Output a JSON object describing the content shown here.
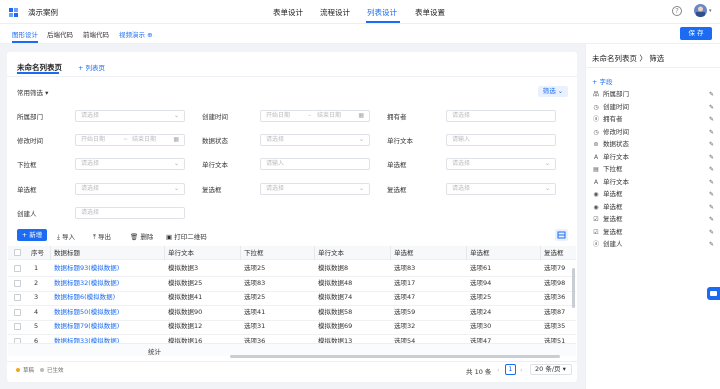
{
  "app": {
    "title": "演示案例"
  },
  "top_tabs": [
    {
      "label": "表单设计"
    },
    {
      "label": "流程设计"
    },
    {
      "label": "列表设计"
    },
    {
      "label": "表单设置"
    }
  ],
  "header": {
    "help": "?",
    "avatar_caret": "▾"
  },
  "sub_tabs": [
    {
      "label": "图形设计"
    },
    {
      "label": "后端代码"
    },
    {
      "label": "前端代码"
    },
    {
      "label": "视频演示 ⊕"
    }
  ],
  "save_label": "保 存",
  "card": {
    "title": "未命名列表页",
    "add_list": "+ 列表页",
    "common_filter": "常用筛选 ▾",
    "filter_btn": "筛选 ⌄"
  },
  "filters": {
    "row1": {
      "dept_label": "所属部门",
      "dept_ph": "请选择",
      "created_label": "创建时间",
      "start_ph": "开始日期",
      "dash": "–",
      "end_ph": "结束日期",
      "owner_label": "拥有者",
      "owner_ph": "请选择"
    },
    "row2": {
      "modified_label": "修改时间",
      "start_ph": "开始日期",
      "dash": "~",
      "end_ph": "结束日期",
      "status_label": "数据状态",
      "status_ph": "请选择",
      "text_label": "单行文本",
      "text_ph": "请输入"
    },
    "row3": {
      "dropdown_label": "下拉框",
      "dropdown_ph": "请选择",
      "text_label": "单行文本",
      "text_ph": "请输入",
      "radio_label": "单选框",
      "radio_ph": "请选择"
    },
    "row4": {
      "radio_label": "单选框",
      "radio_ph": "请选择",
      "checkbox_label": "复选框",
      "checkbox_ph": "请选择",
      "checkbox2_label": "复选框",
      "checkbox2_ph": "请选择"
    },
    "row5": {
      "creator_label": "创建人",
      "creator_ph": "请选择"
    }
  },
  "actions": {
    "new": "+ 新增",
    "import": "导入",
    "export": "导出",
    "delete": "删除",
    "print_qr": "打印二维码"
  },
  "table": {
    "headers": [
      "序号",
      "数据标题",
      "单行文本",
      "下拉框",
      "单行文本",
      "单选框",
      "单选框",
      "复选框"
    ],
    "rows": [
      [
        "1",
        "数据标题93(模拟数据)",
        "模拟数据3",
        "选项25",
        "模拟数据8",
        "选项83",
        "选项61",
        "选项79"
      ],
      [
        "2",
        "数据标题32(模拟数据)",
        "模拟数据25",
        "选项83",
        "模拟数据48",
        "选项17",
        "选项94",
        "选项98"
      ],
      [
        "3",
        "数据标题6(模拟数据)",
        "模拟数据41",
        "选项25",
        "模拟数据74",
        "选项47",
        "选项25",
        "选项36"
      ],
      [
        "4",
        "数据标题50(模拟数据)",
        "模拟数据90",
        "选项41",
        "模拟数据58",
        "选项59",
        "选项24",
        "选项87"
      ],
      [
        "5",
        "数据标题79(模拟数据)",
        "模拟数据12",
        "选项31",
        "模拟数据69",
        "选项32",
        "选项30",
        "选项35"
      ],
      [
        "6",
        "数据标题33(模拟数据)",
        "模拟数据16",
        "选项36",
        "模拟数据13",
        "选项54",
        "选项47",
        "选项51"
      ]
    ],
    "summary": "统计"
  },
  "footer": {
    "legend_published": "草稿",
    "legend_effective": "已生效",
    "total": "共 10 条",
    "prev": "‹",
    "page": "1",
    "next": "›",
    "page_size": "20 条/页 ▾"
  },
  "right_panel": {
    "title": "未命名列表页 〉 筛选",
    "add_field": "+ 字段",
    "items": [
      {
        "icon": "品",
        "label": "所属部门"
      },
      {
        "icon": "◷",
        "label": "创建时间"
      },
      {
        "icon": "ⓐ",
        "label": "拥有者"
      },
      {
        "icon": "◷",
        "label": "修改时间"
      },
      {
        "icon": "⊜",
        "label": "数据状态"
      },
      {
        "icon": "A",
        "label": "单行文本"
      },
      {
        "icon": "▤",
        "label": "下拉框"
      },
      {
        "icon": "A",
        "label": "单行文本"
      },
      {
        "icon": "◉",
        "label": "单选框"
      },
      {
        "icon": "◉",
        "label": "单选框"
      },
      {
        "icon": "☑",
        "label": "复选框"
      },
      {
        "icon": "☑",
        "label": "复选框"
      },
      {
        "icon": "ⓐ",
        "label": "创建人"
      }
    ]
  },
  "colors": {
    "accent": "#1b6cf2"
  }
}
